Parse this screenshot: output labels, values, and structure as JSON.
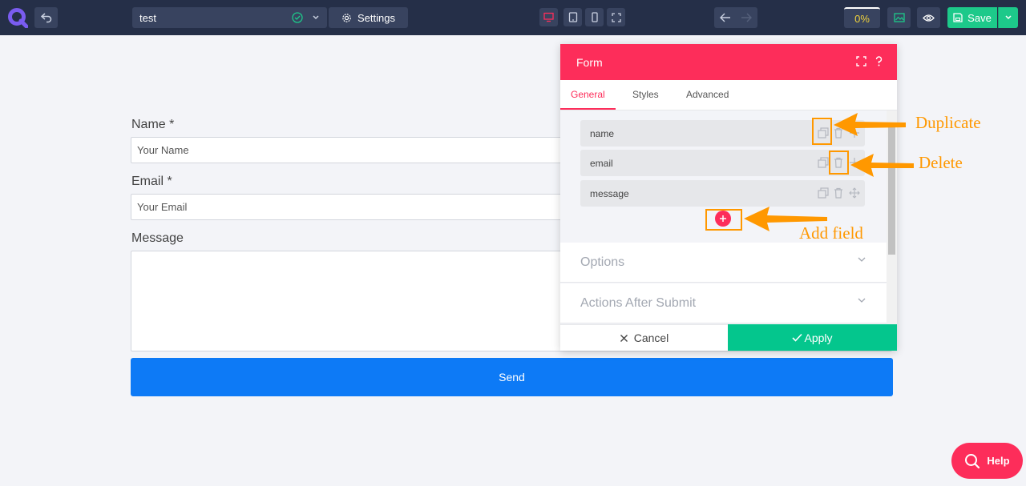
{
  "topbar": {
    "title": "test",
    "settings_label": "Settings",
    "progress": "0%",
    "save_label": "Save"
  },
  "form": {
    "name_label": "Name *",
    "name_placeholder": "Your Name",
    "email_label": "Email *",
    "email_placeholder": "Your Email",
    "message_label": "Message",
    "send_label": "Send"
  },
  "panel": {
    "title": "Form",
    "tabs": [
      {
        "label": "General",
        "active": true
      },
      {
        "label": "Styles",
        "active": false
      },
      {
        "label": "Advanced",
        "active": false
      }
    ],
    "fields": [
      {
        "label": "name"
      },
      {
        "label": "email"
      },
      {
        "label": "message"
      }
    ],
    "sections": [
      {
        "label": "Options"
      },
      {
        "label": "Actions After Submit"
      }
    ],
    "cancel_label": "Cancel",
    "apply_label": "Apply"
  },
  "annotations": {
    "duplicate": "Duplicate",
    "delete": "Delete",
    "add_field": "Add field"
  },
  "help_label": "Help",
  "colors": {
    "topbar": "#252f48",
    "accent": "#fd2d5a",
    "apply": "#04c68d",
    "send": "#0d7af6",
    "annotation": "#ff9800"
  }
}
